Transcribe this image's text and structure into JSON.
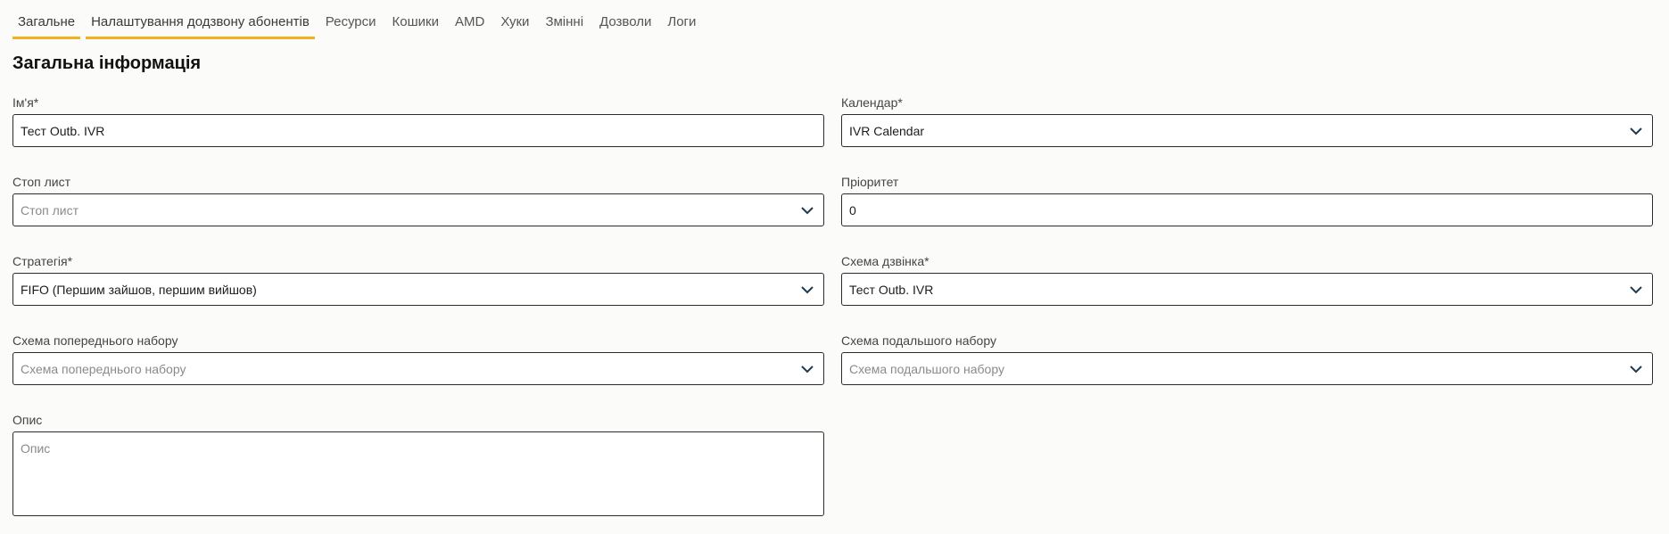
{
  "tabs": [
    {
      "label": "Загальне",
      "active": true
    },
    {
      "label": "Налаштування додзвону абонентів",
      "active": true
    },
    {
      "label": "Ресурси",
      "active": false
    },
    {
      "label": "Кошики",
      "active": false
    },
    {
      "label": "AMD",
      "active": false
    },
    {
      "label": "Хуки",
      "active": false
    },
    {
      "label": "Змінні",
      "active": false
    },
    {
      "label": "Дозволи",
      "active": false
    },
    {
      "label": "Логи",
      "active": false
    }
  ],
  "section_title": "Загальна інформація",
  "fields": {
    "name": {
      "label": "Ім'я*",
      "value": "Тест Outb. IVR"
    },
    "calendar": {
      "label": "Календар*",
      "value": "IVR Calendar"
    },
    "stop_list": {
      "label": "Стоп лист",
      "placeholder": "Стоп лист"
    },
    "priority": {
      "label": "Пріоритет",
      "value": "0"
    },
    "strategy": {
      "label": "Стратегія*",
      "value": "FIFO (Першим зайшов, першим вийшов)"
    },
    "call_scheme": {
      "label": "Схема дзвінка*",
      "value": "Тест Outb. IVR"
    },
    "pre_dial_scheme": {
      "label": "Схема попереднього набору",
      "placeholder": "Схема попереднього набору"
    },
    "post_dial_scheme": {
      "label": "Схема подальшого набору",
      "placeholder": "Схема подальшого набору"
    },
    "description": {
      "label": "Опис",
      "placeholder": "Опис"
    }
  },
  "colors": {
    "accent": "#f2b01e",
    "border": "#2b2b2b",
    "background": "#fbfbfa"
  }
}
